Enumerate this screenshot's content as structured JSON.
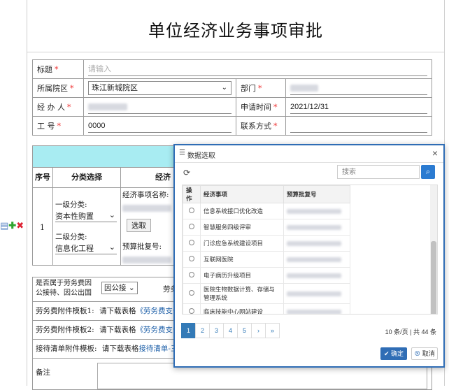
{
  "page": {
    "title": "单位经济业务事项审批"
  },
  "form": {
    "title_label": "标题",
    "title_placeholder": "请输入",
    "hospital_label": "所属院区",
    "hospital_value": "珠江新城院区",
    "department_label": "部门",
    "handler_label": "经 办 人",
    "apply_time_label": "申请时间",
    "apply_time_value": "2021/12/31",
    "employee_no_label": "工 号",
    "employee_no_value": "0000",
    "contact_label": "联系方式"
  },
  "detail": {
    "col_no": "序号",
    "col_category": "分类选择",
    "col_matter": "经济",
    "row_no": "1",
    "level1_label": "一级分类:",
    "level1_value": "资本性购置",
    "level2_label": "二级分类:",
    "level2_value": "信息化工程",
    "matter_name_label": "经济事项名称:",
    "select_button": "选取",
    "budget_no_label": "预算批复号:"
  },
  "bottom": {
    "labor_question": "是否属于劳务费因公接待、因公出国",
    "labor_select": "因公接",
    "labor_right": "劳务",
    "attach1_label": "劳务费附件模板1:",
    "attach1_text": "请下载表格",
    "attach1_link": "《劳务费支付表",
    "attach2_label": "劳务费附件模板2:",
    "attach2_text": "请下载表格",
    "attach2_link": "《劳务费支付表",
    "reception_label": "接待清单附件模板:",
    "reception_text": "请下载表格",
    "reception_link": "接待清单-三公",
    "remark_label": "备注"
  },
  "modal": {
    "title": "数据选取",
    "search_placeholder": "搜索",
    "col_action": "操作",
    "col_matter": "经济事项",
    "col_budget": "预算批复号",
    "rows": [
      {
        "name": "信息系统接口优化改造"
      },
      {
        "name": "智慧服务四级评审"
      },
      {
        "name": "门诊应急系统建设项目"
      },
      {
        "name": "互联网医院"
      },
      {
        "name": "电子病历升级项目"
      },
      {
        "name": "医院生物数据计算、存储与管理系统"
      },
      {
        "name": "临床技能中心网站建设"
      }
    ],
    "pages": [
      "1",
      "2",
      "3",
      "4",
      "5",
      "›",
      "»"
    ],
    "active_page": "1",
    "page_info": "10 条/页 | 共 44 条",
    "ok_label": "确定",
    "cancel_label": "取消"
  },
  "icons": {
    "row_actions": [
      "document-icon",
      "add-icon",
      "delete-icon"
    ]
  }
}
